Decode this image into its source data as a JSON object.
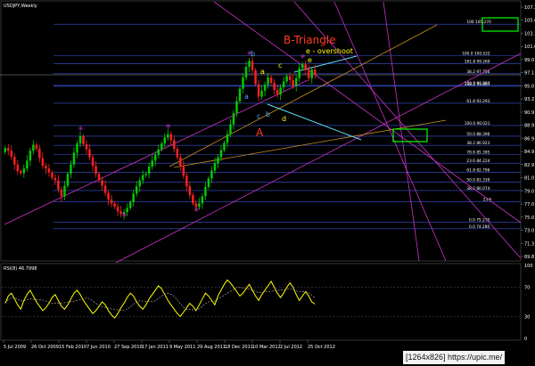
{
  "window": {
    "symbol_title": "USDJPY,Weekly",
    "indicator_title": "RSI(8) 46.7998"
  },
  "watermark": "[1264x826] https://upic.me/",
  "annotations": {
    "pattern_title": "B-Triangle",
    "overshoot_label": "e - overshoot",
    "wave_labels": [
      "a",
      "b",
      "c",
      "d",
      "e"
    ],
    "wave_big": "A"
  },
  "colors": {
    "background": "#000000",
    "bull_candle": "#00cc00",
    "bear_candle": "#ff2020",
    "rsi_line": "#ffff00",
    "fib_line": "#3a55d8",
    "channel": "#cc33cc",
    "highlight_box": "#00ff00",
    "title_red": "#ff3b1f"
  },
  "chart_data": {
    "type": "line",
    "ylim": [
      69.8,
      108.4
    ],
    "yticks": [
      "107.3",
      "105.6",
      "103.1",
      "101.0",
      "99.0",
      "97.1",
      "95.0",
      "93.2",
      "90.9",
      "88.9",
      "86.9",
      "84.9",
      "82.9",
      "81.0",
      "79.0",
      "77.0",
      "75.0",
      "73.0",
      "71.3",
      "69.8"
    ],
    "xticks": [
      "5 Jul 2009",
      "26 Oct 2009",
      "15 Feb 2010",
      "7 Jun 2010",
      "27 Sep 2010",
      "17 Jan 2011",
      "9 May 2011",
      "29 Aug 2011",
      "18 Dec 2011",
      "10 Mar 2012",
      "2 Jul 2012",
      "25 Oct 2012"
    ],
    "fib_levels": [
      {
        "label": "100 105.270",
        "price": 105.27
      },
      {
        "label": "100.0 100.522",
        "price": 100.52
      },
      {
        "label": "161.8 99.269",
        "price": 99.27
      },
      {
        "label": "38.2 97.756",
        "price": 97.76
      },
      {
        "label": "100.0 95.993",
        "price": 95.99
      },
      {
        "label": "138.2 95.867",
        "price": 95.87
      },
      {
        "label": "61.8 93.293",
        "price": 93.29
      },
      {
        "label": "100.0 90.021",
        "price": 89.92
      },
      {
        "label": "50.0 88.396",
        "price": 88.3
      },
      {
        "label": "38.2 86.923",
        "price": 86.92
      },
      {
        "label": "78.6 85.395",
        "price": 85.49
      },
      {
        "label": "23.6 84.224",
        "price": 84.22
      },
      {
        "label": "61.8 82.796",
        "price": 82.8
      },
      {
        "label": "50.0 81.339",
        "price": 81.33
      },
      {
        "label": "38.2 80.074",
        "price": 80.07
      },
      {
        "label": "23.6",
        "price": 78.35
      },
      {
        "label": "0.0 75.270",
        "price": 75.27
      },
      {
        "label": "0.0 74.280",
        "price": 74.28
      }
    ],
    "close_series": [
      86.5,
      86.1,
      85.2,
      84.0,
      83.0,
      82.7,
      83.4,
      84.6,
      86.1,
      87.0,
      86.4,
      85.0,
      83.8,
      83.4,
      82.8,
      82.0,
      81.6,
      80.2,
      79.2,
      80.8,
      82.6,
      84.0,
      85.8,
      87.2,
      88.3,
      87.1,
      86.3,
      85.1,
      83.8,
      82.6,
      81.6,
      80.8,
      79.7,
      78.7,
      78.1,
      77.6,
      76.9,
      76.5,
      76.8,
      77.4,
      78.3,
      79.6,
      80.7,
      81.6,
      82.4,
      82.6,
      83.7,
      84.6,
      85.5,
      86.3,
      87.2,
      88.1,
      88.6,
      87.7,
      86.4,
      85.1,
      83.8,
      82.3,
      80.7,
      79.4,
      78.1,
      77.6,
      78.1,
      79.2,
      80.6,
      81.9,
      83.1,
      84.2,
      85.1,
      86.2,
      87.3,
      88.6,
      90.1,
      91.8,
      93.6,
      95.5,
      97.2,
      98.8,
      99.7,
      98.3,
      96.2,
      94.3,
      95.2,
      96.1,
      97.2,
      96.4,
      95.3,
      94.6,
      95.7,
      96.6,
      97.4,
      96.8,
      95.9,
      97.1,
      98.6,
      99.2,
      98.3,
      97.1,
      98.4,
      97.6
    ],
    "rsi": {
      "title": "RSI(8) 46.7998",
      "ylim": [
        0,
        100
      ],
      "yticks": [
        "100",
        "70",
        "30",
        "0"
      ],
      "values": [
        48,
        58,
        62,
        54,
        46,
        40,
        52,
        60,
        66,
        58,
        50,
        44,
        38,
        42,
        48,
        56,
        60,
        52,
        44,
        40,
        46,
        54,
        62,
        66,
        60,
        52,
        46,
        40,
        34,
        38,
        44,
        50,
        46,
        38,
        32,
        28,
        34,
        42,
        48,
        56,
        62,
        58,
        50,
        44,
        40,
        46,
        54,
        60,
        66,
        72,
        68,
        60,
        52,
        46,
        40,
        34,
        30,
        36,
        42,
        48,
        44,
        38,
        46,
        54,
        62,
        58,
        52,
        46,
        58,
        66,
        74,
        80,
        76,
        70,
        64,
        58,
        62,
        68,
        74,
        66,
        58,
        52,
        60,
        66,
        72,
        78,
        70,
        62,
        56,
        62,
        70,
        76,
        70,
        60,
        52,
        58,
        64,
        58,
        50,
        47
      ]
    }
  }
}
